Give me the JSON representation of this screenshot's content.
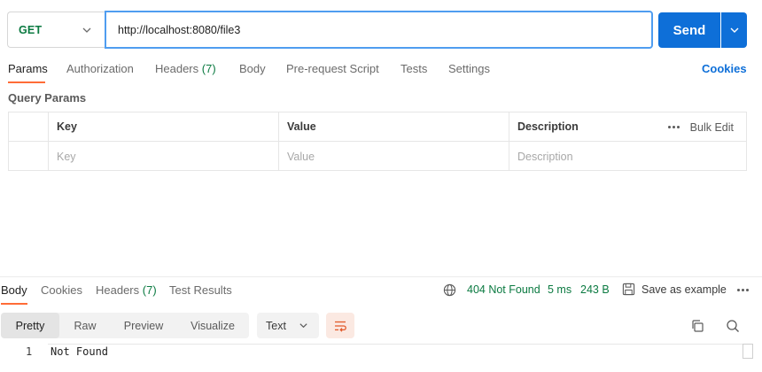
{
  "request": {
    "method": "GET",
    "url": "http://localhost:8080/file3",
    "send_label": "Send"
  },
  "request_tabs": [
    {
      "label": "Params",
      "active": true
    },
    {
      "label": "Authorization"
    },
    {
      "label": "Headers",
      "count": "(7)"
    },
    {
      "label": "Body"
    },
    {
      "label": "Pre-request Script"
    },
    {
      "label": "Tests"
    },
    {
      "label": "Settings"
    }
  ],
  "cookies_label": "Cookies",
  "query_params": {
    "title": "Query Params",
    "columns": [
      "Key",
      "Value",
      "Description"
    ],
    "bulk_edit_label": "Bulk Edit",
    "placeholders": [
      "Key",
      "Value",
      "Description"
    ]
  },
  "response_tabs": [
    {
      "label": "Body",
      "active": true
    },
    {
      "label": "Cookies"
    },
    {
      "label": "Headers",
      "count": "(7)"
    },
    {
      "label": "Test Results"
    }
  ],
  "response_status": {
    "status": "404 Not Found",
    "time": "5 ms",
    "size": "243 B",
    "color": "#0b7a41"
  },
  "save_example_label": "Save as example",
  "body_view": {
    "modes": [
      "Pretty",
      "Raw",
      "Preview",
      "Visualize"
    ],
    "active_mode": "Pretty",
    "format": "Text"
  },
  "response_body": {
    "lines": [
      {
        "number": "1",
        "text": "Not Found"
      }
    ]
  },
  "colors": {
    "accent": "#ff6c37",
    "primary": "#0e6fd8",
    "success": "#0b7a41",
    "focus_border": "#4f9df0"
  },
  "icons": [
    "chevron-down-icon",
    "globe-icon",
    "save-icon",
    "more-icon",
    "wrap-lines-icon",
    "copy-icon",
    "search-icon"
  ]
}
